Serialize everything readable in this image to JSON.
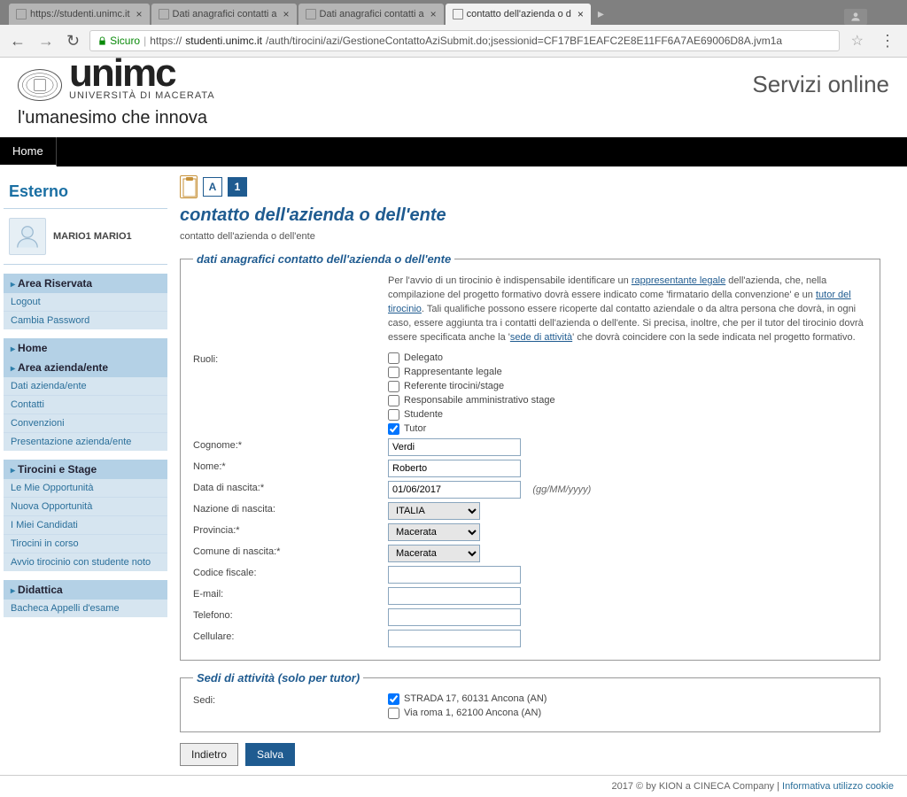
{
  "browser": {
    "tabs": [
      {
        "title": "https://studenti.unimc.it",
        "active": false
      },
      {
        "title": "Dati anagrafici contatti a",
        "active": false
      },
      {
        "title": "Dati anagrafici contatti a",
        "active": false
      },
      {
        "title": "contatto dell'azienda o d",
        "active": true
      }
    ],
    "secure_label": "Sicuro",
    "url_prefix": "https://",
    "url_host": "studenti.unimc.it",
    "url_path": "/auth/tirocini/azi/GestioneContattoAziSubmit.do;jsessionid=CF17BF1EAFC2E8E11FF6A7AE69006D8A.jvm1a"
  },
  "header": {
    "brand": "unimc",
    "brand_sub": "UNIVERSITÀ DI MACERATA",
    "tagline": "l'umanesimo che innova",
    "servizi": "Servizi online",
    "nav_home": "Home"
  },
  "sidebar": {
    "title": "Esterno",
    "username": "MARIO1 MARIO1",
    "area_riservata": {
      "label": "Area Riservata",
      "items": [
        "Logout",
        "Cambia Password"
      ]
    },
    "home": "Home",
    "area_azienda": {
      "label": "Area azienda/ente",
      "items": [
        "Dati azienda/ente",
        "Contatti",
        "Convenzioni",
        "Presentazione azienda/ente"
      ]
    },
    "tirocini": {
      "label": "Tirocini e Stage",
      "items": [
        "Le Mie Opportunità",
        "Nuova Opportunità",
        "I Miei Candidati",
        "Tirocini in corso",
        "Avvio tirocinio con studente noto"
      ]
    },
    "didattica": {
      "label": "Didattica",
      "items": [
        "Bacheca Appelli d'esame"
      ]
    }
  },
  "breadcrumb": {
    "step_a": "A",
    "step_1": "1"
  },
  "content": {
    "title": "contatto dell'azienda o dell'ente",
    "subtitle": "contatto dell'azienda o dell'ente",
    "fieldset1_legend": "dati anagrafici contatto dell'azienda o dell'ente",
    "intro_p1a": "Per l'avvio di un tirocinio è indispensabile identificare un ",
    "intro_link1": "rappresentante legale",
    "intro_p1b": " dell'azienda, che, nella compilazione del progetto formativo dovrà essere indicato come 'firmatario della convenzione' e un ",
    "intro_link2": "tutor del tirocinio",
    "intro_p1c": ". Tali qualifiche possono essere ricoperte dal contatto aziendale o da altra persona che dovrà, in ogni caso, essere aggiunta tra i contatti dell'azienda o dell'ente. Si precisa, inoltre, che per il tutor del tirocinio dovrà essere specificata anche la '",
    "intro_link3": "sede di attività",
    "intro_p1d": "' che dovrà coincidere con la sede indicata nel progetto formativo.",
    "labels": {
      "ruoli": "Ruoli:",
      "cognome": "Cognome:*",
      "nome": "Nome:*",
      "data_nascita": "Data di nascita:*",
      "nazione": "Nazione di nascita:",
      "provincia": "Provincia:*",
      "comune": "Comune di nascita:*",
      "cf": "Codice fiscale:",
      "email": "E-mail:",
      "telefono": "Telefono:",
      "cellulare": "Cellulare:"
    },
    "ruoli": [
      {
        "label": "Delegato",
        "checked": false
      },
      {
        "label": "Rappresentante legale",
        "checked": false
      },
      {
        "label": "Referente tirocini/stage",
        "checked": false
      },
      {
        "label": "Responsabile amministrativo stage",
        "checked": false
      },
      {
        "label": "Studente",
        "checked": false
      },
      {
        "label": "Tutor",
        "checked": true
      }
    ],
    "values": {
      "cognome": "Verdi",
      "nome": "Roberto",
      "data_nascita": "01/06/2017",
      "nazione": "ITALIA",
      "provincia": "Macerata",
      "comune": "Macerata",
      "cf": "",
      "email": "",
      "telefono": "",
      "cellulare": ""
    },
    "date_hint": "(gg/MM/yyyy)",
    "fieldset2_legend": "Sedi di attività (solo per tutor)",
    "sedi_label": "Sedi:",
    "sedi": [
      {
        "label": "STRADA 17, 60131 Ancona (AN)",
        "checked": true
      },
      {
        "label": "Via roma 1, 62100 Ancona (AN)",
        "checked": false
      }
    ],
    "btn_back": "Indietro",
    "btn_save": "Salva"
  },
  "footer": {
    "copy": "2017 © by KION a CINECA Company",
    "sep": " | ",
    "link": "Informativa utilizzo cookie"
  }
}
